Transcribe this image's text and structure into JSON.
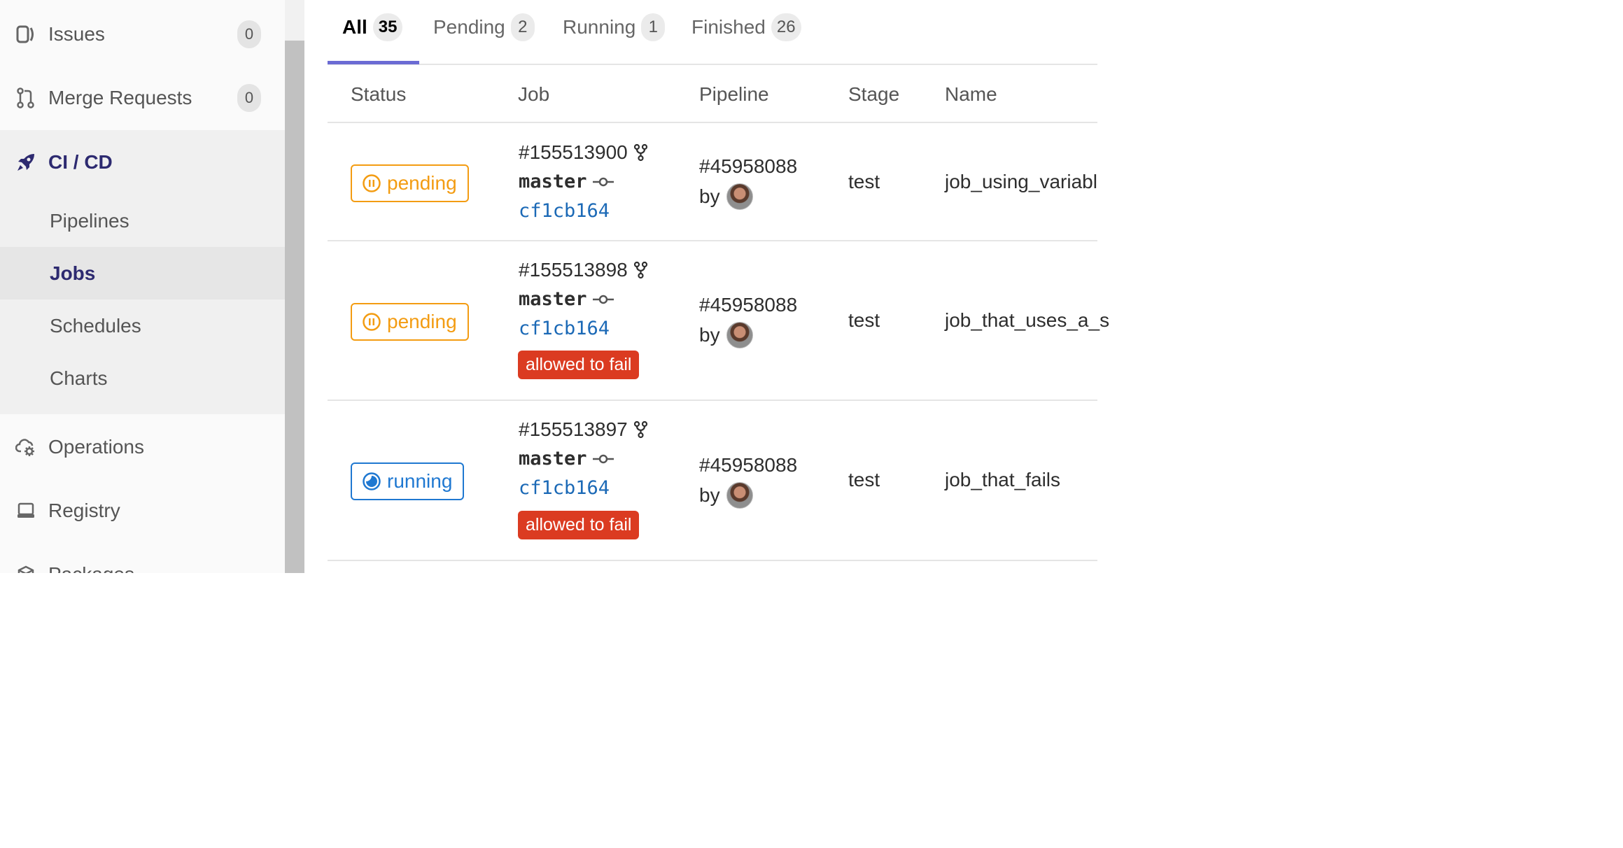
{
  "sidebar": {
    "issues": {
      "label": "Issues",
      "count": "0"
    },
    "merge_requests": {
      "label": "Merge Requests",
      "count": "0"
    },
    "cicd": {
      "label": "CI / CD",
      "items": [
        {
          "label": "Pipelines"
        },
        {
          "label": "Jobs"
        },
        {
          "label": "Schedules"
        },
        {
          "label": "Charts"
        }
      ]
    },
    "operations": {
      "label": "Operations"
    },
    "registry": {
      "label": "Registry"
    },
    "packages": {
      "label": "Packages"
    }
  },
  "tabs": [
    {
      "label": "All",
      "count": "35"
    },
    {
      "label": "Pending",
      "count": "2"
    },
    {
      "label": "Running",
      "count": "1"
    },
    {
      "label": "Finished",
      "count": "26"
    }
  ],
  "table": {
    "headers": {
      "status": "Status",
      "job": "Job",
      "pipeline": "Pipeline",
      "stage": "Stage",
      "name": "Name"
    },
    "rows": [
      {
        "status": "pending",
        "job_id": "#155513900",
        "branch": "master",
        "sha": "cf1cb164",
        "pipeline": "#45958088",
        "by": "by",
        "stage": "test",
        "name": "job_using_variabl"
      },
      {
        "status": "pending",
        "job_id": "#155513898",
        "branch": "master",
        "sha": "cf1cb164",
        "allowed_to_fail": "allowed to fail",
        "pipeline": "#45958088",
        "by": "by",
        "stage": "test",
        "name": "job_that_uses_a_s"
      },
      {
        "status": "running",
        "job_id": "#155513897",
        "branch": "master",
        "sha": "cf1cb164",
        "allowed_to_fail": "allowed to fail",
        "pipeline": "#45958088",
        "by": "by",
        "stage": "test",
        "name": "job_that_fails"
      }
    ]
  },
  "colors": {
    "accent": "#2d2a70",
    "pending": "#f39c12",
    "running": "#1f78d1",
    "danger": "#db3b21",
    "link": "#1b69b6"
  }
}
